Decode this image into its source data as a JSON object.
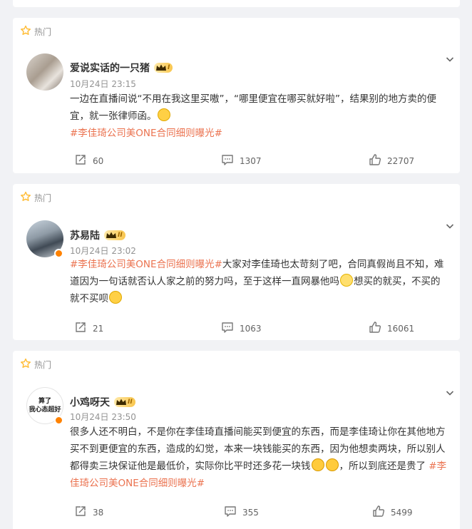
{
  "colors": {
    "background": "#f1f2f5",
    "topic": "#eb7350",
    "muted": "#939393",
    "hot_icon": "#ffbb33"
  },
  "posts": [
    {
      "hot_label": "热门",
      "author": "爱说实话的一只猪",
      "vip_level": "I",
      "time": "10月24日 23:15",
      "text_1": "一边在直播间说“不用在我这里买嗷”，“哪里便宜在哪买就好啦”，结果别的地方卖的便宜，就一张律师函。",
      "topic": "#李佳琦公司美ONE合同细则曝光#",
      "reposts": "60",
      "comments": "1307",
      "likes": "22707"
    },
    {
      "hot_label": "热门",
      "author": "苏易陆",
      "vip_level": "II",
      "time": "10月24日 23:02",
      "topic": "#李佳琦公司美ONE合同细则曝光#",
      "text_1": "大家对李佳琦也太苛刻了吧，合同真假尚且不知，难道因为一句话就否认人家之前的努力吗，至于这样一直网暴他吗",
      "text_2": "想买的就买，不买的就不买呗",
      "reposts": "21",
      "comments": "1063",
      "likes": "16061"
    },
    {
      "hot_label": "热门",
      "author": "小鸡呀天",
      "vip_level": "II",
      "avatar_text_1": "算了",
      "avatar_text_2": "我心态超好",
      "time": "10月24日 23:50",
      "text_1": "很多人还不明白，不是你在李佳琦直播间能买到便宜的东西，而是李佳琦让你在其他地方买不到更便宜的东西，造成的幻觉，本来一块钱能买的东西，因为他想卖两块，所以别人都得卖三块保证他是最低价，实际你比平时还多花一块钱",
      "text_2": "，所以到底还是贵了",
      "topic": "#李佳琦公司美ONE合同细则曝光#",
      "reposts": "38",
      "comments": "355",
      "likes": "5499"
    }
  ]
}
